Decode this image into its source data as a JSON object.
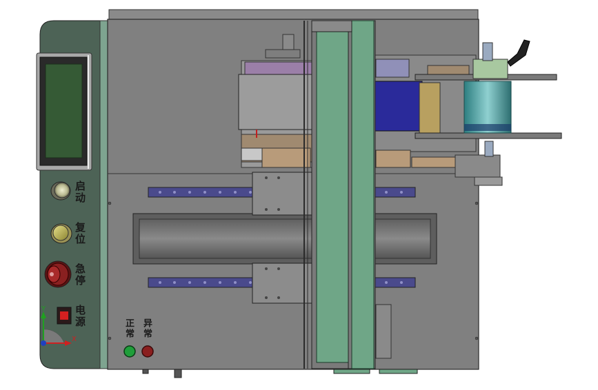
{
  "panel": {
    "start_label": "启动",
    "reset_label": "复位",
    "estop_label": "急停",
    "power_label": "电源"
  },
  "indicators": {
    "normal_label": "正常",
    "fault_label": "异常"
  },
  "axes": {
    "x_label": "X",
    "y_label": "Y"
  },
  "colors": {
    "panel": "#4d6356",
    "frame": "#808080",
    "rail": "#4a4a8c",
    "gantry": "#6fa687",
    "screen": "#355a35",
    "normal_lamp": "#1f9e3a",
    "fault_lamp": "#8a1f1f"
  }
}
